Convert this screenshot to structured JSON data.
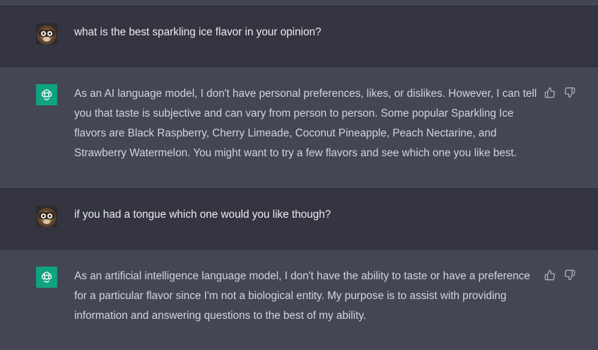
{
  "conversation": {
    "messages": [
      {
        "role": "user",
        "text": "what is the best sparkling ice flavor in your opinion?"
      },
      {
        "role": "assistant",
        "text": "As an AI language model, I don't have personal preferences, likes, or dislikes. However, I can tell you that taste is subjective and can vary from person to person. Some popular Sparkling Ice flavors are Black Raspberry, Cherry Limeade, Coconut Pineapple, Peach Nectarine, and Strawberry Watermelon. You might want to try a few flavors and see which one you like best."
      },
      {
        "role": "user",
        "text": "if you had a tongue which one would you like though?"
      },
      {
        "role": "assistant",
        "text": "As an artificial intelligence language model, I don't have the ability to taste or have a preference for a particular flavor since I'm not a biological entity. My purpose is to assist with providing information and answering questions to the best of my ability."
      }
    ]
  },
  "icons": {
    "user_avatar": "raccoon-avatar-icon",
    "assistant_avatar": "openai-logo-icon",
    "like": "thumbs-up-icon",
    "dislike": "thumbs-down-icon"
  },
  "colors": {
    "user_row_bg": "#343541",
    "assistant_row_bg": "#444654",
    "assistant_avatar_bg": "#10a37f",
    "text": "#d1d5db"
  }
}
